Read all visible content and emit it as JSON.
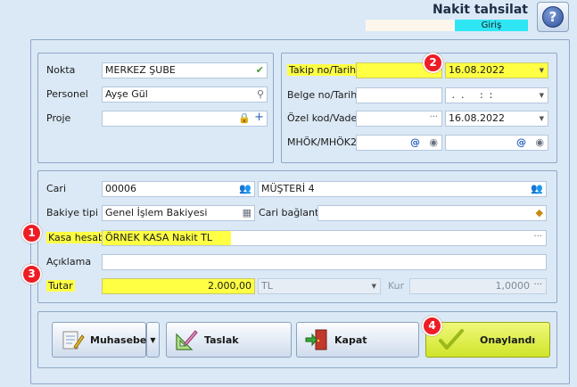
{
  "header": {
    "title": "Nakit tahsilat",
    "mode_label": "Giriş",
    "help_symbol": "?"
  },
  "left_panel": {
    "nokta": {
      "label": "Nokta",
      "value": "MERKEZ ŞUBE"
    },
    "personel": {
      "label": "Personel",
      "value": "Ayşe Gül"
    },
    "proje": {
      "label": "Proje",
      "value": ""
    }
  },
  "right_panel": {
    "takip": {
      "label": "Takip no/Tarih",
      "value": "",
      "date": "16.08.2022"
    },
    "belge": {
      "label": "Belge no/Tarih",
      "value": "",
      "date": " .  .     :  : "
    },
    "ozel_kod": {
      "label": "Özel kod/Vade",
      "value": "",
      "date": "16.08.2022"
    },
    "mhok": {
      "label": "MHÖK/MHÖK2",
      "value1": "",
      "value2": ""
    }
  },
  "middle_panel": {
    "cari": {
      "label": "Cari",
      "code": "00006",
      "name": "MÜŞTERİ 4"
    },
    "bakiye_tipi": {
      "label": "Bakiye tipi",
      "value": "Genel İşlem Bakiyesi"
    },
    "cari_baglanti": {
      "label": "Cari bağlantı",
      "value": ""
    },
    "kasa_hesabi": {
      "label": "Kasa hesabı",
      "value": "ÖRNEK KASA Nakit TL"
    },
    "aciklama": {
      "label": "Açıklama",
      "value": ""
    },
    "tutar": {
      "label": "Tutar",
      "value": "2.000,00",
      "currency": "TL"
    },
    "kur": {
      "label": "Kur",
      "value": "1,0000"
    }
  },
  "buttons": {
    "muhasebe": "Muhasebe",
    "taslak": "Taslak",
    "kapat": "Kapat",
    "onaylandi": "Onaylandı"
  },
  "badges": [
    "1",
    "2",
    "3",
    "4"
  ],
  "colors": {
    "highlight": "#ffff44",
    "mode": "#2fe6f5",
    "badge": "#ee1c25",
    "confirm": "#d6e83a"
  }
}
